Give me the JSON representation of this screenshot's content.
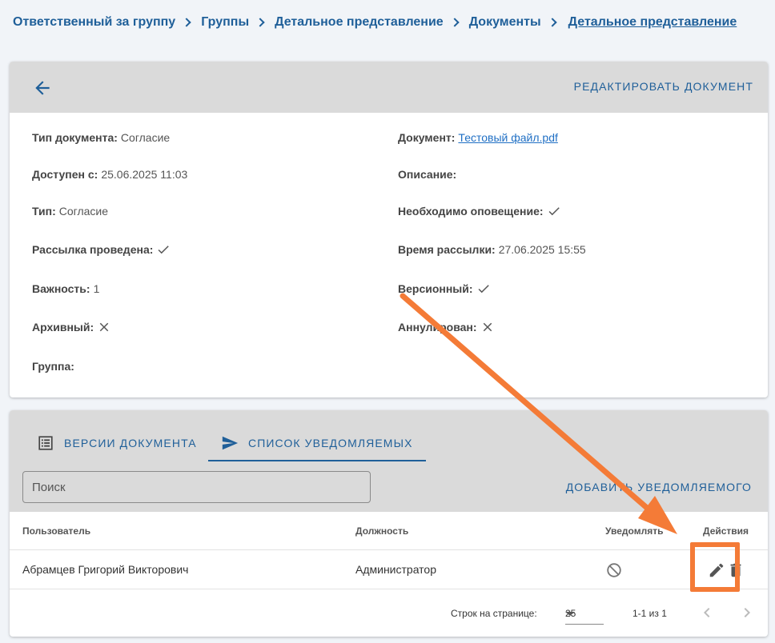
{
  "breadcrumb": {
    "items": [
      "Ответственный за группу",
      "Группы",
      "Детальное представление",
      "Документы"
    ],
    "current": "Детальное представление"
  },
  "document": {
    "edit_label": "Редактировать документ",
    "fields": {
      "type_doc_label": "Тип документа:",
      "type_doc_value": "Согласие",
      "available_label": "Доступен с:",
      "available_value": "25.06.2025 11:03",
      "type_label": "Тип:",
      "type_value": "Согласие",
      "sent_label": "Рассылка проведена:",
      "importance_label": "Важность:",
      "importance_value": "1",
      "archived_label": "Архивный:",
      "group_label": "Группа:",
      "doc_label": "Документ:",
      "doc_value": "Тестовый файл.pdf",
      "description_label": "Описание:",
      "notify_required_label": "Необходимо оповещение:",
      "send_time_label": "Время рассылки:",
      "send_time_value": "27.06.2025 15:55",
      "versioned_label": "Версионный:",
      "cancelled_label": "Аннулирован:"
    }
  },
  "tabs": [
    {
      "label": "Версии документа",
      "icon": "list-icon"
    },
    {
      "label": "Список уведомляемых",
      "icon": "send-icon"
    }
  ],
  "search": {
    "placeholder": "Поиск"
  },
  "add_label": "Добавить уведомляемого",
  "table": {
    "headers": [
      "Пользователь",
      "Должность",
      "Уведомлять",
      "Действия"
    ],
    "rows": [
      {
        "user": "Абрамцев Григорий Викторович",
        "position": "Администратор"
      }
    ]
  },
  "pagination": {
    "rows_per_page_label": "Строк на странице:",
    "rows_per_page": "25",
    "range": "1-1 из 1"
  },
  "colors": {
    "accent": "#1f5f99",
    "annotation": "#f47b37"
  }
}
